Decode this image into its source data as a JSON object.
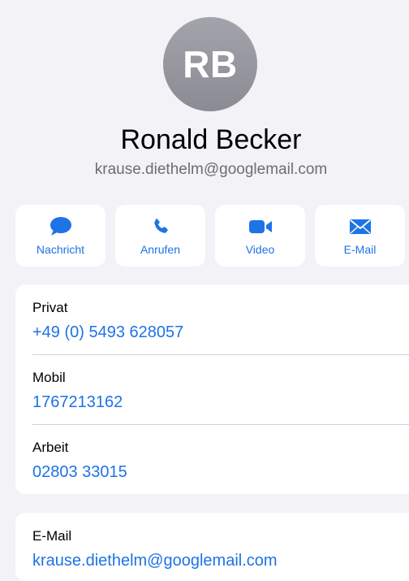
{
  "contact": {
    "initials": "RB",
    "name": "Ronald Becker",
    "subtitle": "krause.diethelm@googlemail.com"
  },
  "actions": [
    {
      "label": "Nachricht",
      "icon": "message-bubble-icon"
    },
    {
      "label": "Anrufen",
      "icon": "phone-icon"
    },
    {
      "label": "Video",
      "icon": "video-camera-icon"
    },
    {
      "label": "E-Mail",
      "icon": "envelope-icon"
    }
  ],
  "phones": [
    {
      "label": "Privat",
      "value": "+49 (0) 5493 628057"
    },
    {
      "label": "Mobil",
      "value": "1767213162"
    },
    {
      "label": "Arbeit",
      "value": "02803 33015"
    }
  ],
  "emails": [
    {
      "label": "E-Mail",
      "value": "krause.diethelm@googlemail.com"
    }
  ],
  "colors": {
    "accent": "#1e73e6",
    "background": "#f2f2f7",
    "avatar": "#9a9aa2"
  }
}
